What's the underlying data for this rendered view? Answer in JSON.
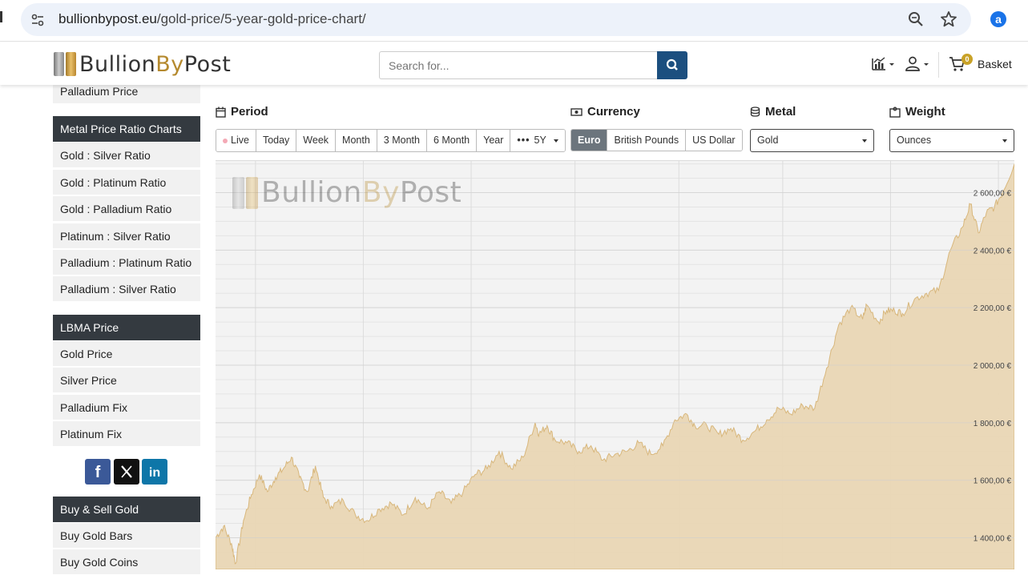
{
  "browser": {
    "url_host": "bullionbypost.eu",
    "url_path": "/gold-price/5-year-gold-price-chart/"
  },
  "header": {
    "logo_part1": "Bullion",
    "logo_part2": "By",
    "logo_part3": "Post",
    "search_placeholder": "Search for...",
    "cart_count": "0",
    "basket_label": "Basket"
  },
  "sidebar": {
    "top_item": "Palladium Price",
    "ratio_heading": "Metal Price Ratio Charts",
    "ratio_items": [
      "Gold : Silver Ratio",
      "Gold : Platinum Ratio",
      "Gold : Palladium Ratio",
      "Platinum : Silver Ratio",
      "Palladium : Platinum Ratio",
      "Palladium : Silver Ratio"
    ],
    "lbma_heading": "LBMA Price",
    "lbma_items": [
      "Gold Price",
      "Silver Price",
      "Palladium Fix",
      "Platinum Fix"
    ],
    "buy_heading": "Buy & Sell Gold",
    "buy_items": [
      "Buy Gold Bars",
      "Buy Gold Coins"
    ],
    "social": {
      "facebook": "f",
      "x": "X",
      "linkedin": "in"
    }
  },
  "controls": {
    "period_label": "Period",
    "period_options": [
      "Live",
      "Today",
      "Week",
      "Month",
      "3 Month",
      "6 Month",
      "Year"
    ],
    "period_more": "5Y",
    "currency_label": "Currency",
    "currency_options": [
      "Euro",
      "British Pounds",
      "US Dollar"
    ],
    "currency_selected": "Euro",
    "metal_label": "Metal",
    "metal_selected": "Gold",
    "weight_label": "Weight",
    "weight_selected": "Ounces"
  },
  "chart_data": {
    "type": "area",
    "ylabels": [
      "2 600,00 €",
      "2 400,00 €",
      "2 200,00 €",
      "2 000,00 €",
      "1 800,00 €",
      "1 600,00 €",
      "1 400,00 €"
    ],
    "yticks": [
      2600,
      2400,
      2200,
      2000,
      1800,
      1600,
      1400
    ],
    "ylim": [
      1290,
      2710
    ],
    "x": [
      0,
      0.01,
      0.02,
      0.025,
      0.035,
      0.045,
      0.055,
      0.065,
      0.075,
      0.085,
      0.095,
      0.105,
      0.115,
      0.125,
      0.135,
      0.145,
      0.16,
      0.175,
      0.19,
      0.205,
      0.22,
      0.235,
      0.25,
      0.265,
      0.28,
      0.295,
      0.31,
      0.325,
      0.34,
      0.355,
      0.37,
      0.385,
      0.4,
      0.405,
      0.415,
      0.425,
      0.44,
      0.455,
      0.47,
      0.485,
      0.5,
      0.515,
      0.53,
      0.545,
      0.56,
      0.575,
      0.59,
      0.6,
      0.615,
      0.63,
      0.645,
      0.66,
      0.675,
      0.69,
      0.705,
      0.72,
      0.735,
      0.75,
      0.765,
      0.78,
      0.795,
      0.81,
      0.815,
      0.83,
      0.84,
      0.85,
      0.86,
      0.875,
      0.89,
      0.905,
      0.92,
      0.935,
      0.945,
      0.955,
      0.965,
      0.975,
      0.985,
      1.0
    ],
    "values": [
      1400,
      1440,
      1380,
      1310,
      1460,
      1550,
      1620,
      1560,
      1610,
      1640,
      1680,
      1610,
      1560,
      1650,
      1540,
      1510,
      1530,
      1480,
      1460,
      1500,
      1520,
      1480,
      1540,
      1500,
      1560,
      1520,
      1560,
      1620,
      1640,
      1700,
      1640,
      1680,
      1800,
      1760,
      1790,
      1740,
      1730,
      1700,
      1720,
      1670,
      1690,
      1700,
      1730,
      1690,
      1720,
      1810,
      1830,
      1790,
      1790,
      1760,
      1780,
      1740,
      1770,
      1810,
      1850,
      1830,
      1860,
      1850,
      1990,
      2140,
      2200,
      2160,
      2210,
      2150,
      2190,
      2190,
      2180,
      2230,
      2250,
      2260,
      2400,
      2480,
      2560,
      2460,
      2530,
      2550,
      2600,
      2700
    ]
  }
}
